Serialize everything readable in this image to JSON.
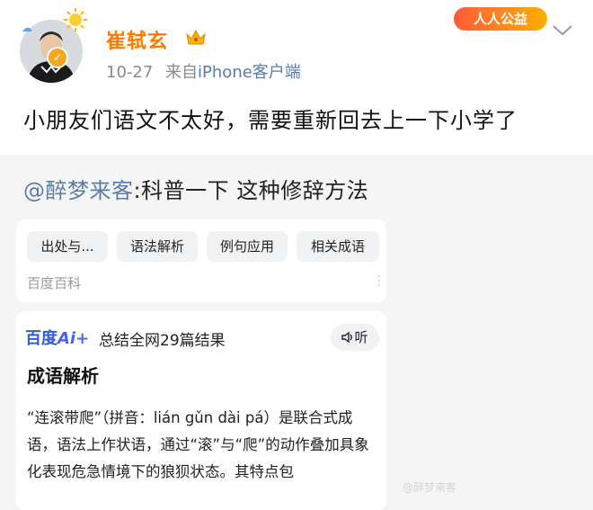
{
  "post": {
    "username": "崔轼玄",
    "time": "10-27",
    "source_prefix": "来自",
    "source_device": "iPhone客户端",
    "badge": "人人公益",
    "text": "小朋友们语文不太好，需要重新回去上一下小学了"
  },
  "repost": {
    "mention": "@醉梦来客",
    "text": ":科普一下 这种修辞方法"
  },
  "baike_card": {
    "chips": [
      "出处与...",
      "语法解析",
      "例句应用",
      "相关成语"
    ],
    "source": "百度百科"
  },
  "ai_card": {
    "logo_text": "百度",
    "logo_ai": "Ai+",
    "summary": "总结全网29篇结果",
    "listen_label": "听",
    "section_title": "成语解析",
    "paragraph": "“连滚带爬”（拼音：lián gǔn dài pá）是联合式成语，语法上作状语，通过“滚”与“爬”的动作叠加具象化表现危急情境下的狼狈状态。其特点包"
  },
  "watermark": "@醉梦来客",
  "colors": {
    "username": "#ff7a00",
    "link": "#5b7cab",
    "ai_blue": "#2f5bd9",
    "repost_bg": "#f5f5f5"
  },
  "icons": [
    "cloud-icon",
    "sun-icon",
    "verified-icon",
    "crown-icon",
    "chevron-down-icon",
    "more-dots-icon",
    "speaker-icon"
  ]
}
